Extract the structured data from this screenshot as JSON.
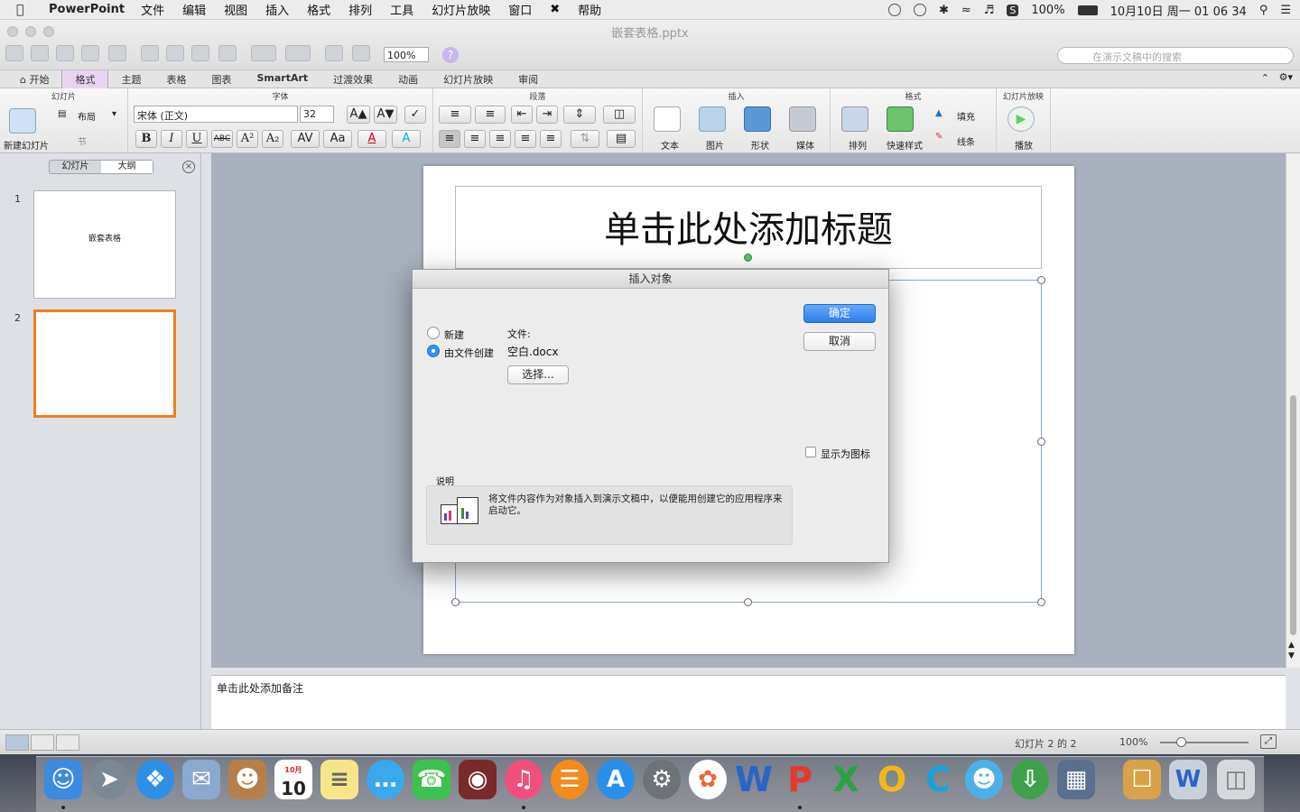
{
  "menubar": {
    "app_name": "PowerPoint",
    "items": [
      "文件",
      "编辑",
      "视图",
      "插入",
      "格式",
      "排列",
      "工具",
      "幻灯片放映",
      "窗口",
      "帮助"
    ],
    "battery": "100%",
    "clock": "10月10日 周一  01 06 34"
  },
  "window": {
    "title": "嵌套表格.pptx"
  },
  "toolbar": {
    "zoom": "100%",
    "search_placeholder": "在演示文稿中的搜索"
  },
  "tabs": [
    "开始",
    "格式",
    "主题",
    "表格",
    "图表",
    "SmartArt",
    "过渡效果",
    "动画",
    "幻灯片放映",
    "审阅"
  ],
  "ribbon": {
    "slides_group": "幻灯片",
    "new_slide": "新建幻灯片",
    "layout": "布局",
    "section": "节",
    "font_group": "字体",
    "font_name": "宋体 (正文)",
    "font_size": "32",
    "paragraph_group": "段落",
    "insert_group": "插入",
    "insert_text": "文本",
    "insert_picture": "图片",
    "insert_shape": "形状",
    "insert_media": "媒体",
    "format_group": "格式",
    "arrange": "排列",
    "quick_styles": "快速样式",
    "fill": "填充",
    "line": "线条",
    "slideshow_group": "幻灯片放映",
    "play": "播放"
  },
  "panel": {
    "tab_slides": "幻灯片",
    "tab_outline": "大纲",
    "slides": [
      {
        "num": "1",
        "text": "嵌套表格"
      },
      {
        "num": "2",
        "text": ""
      }
    ]
  },
  "slide": {
    "title_placeholder": "单击此处添加标题"
  },
  "notes": {
    "placeholder": "单击此处添加备注"
  },
  "status": {
    "slide_count": "幻灯片 2 的 2",
    "zoom": "100%"
  },
  "dialog": {
    "title": "插入对象",
    "opt_new": "新建",
    "opt_from_file": "由文件创建",
    "file_label": "文件:",
    "file_name": "空白.docx",
    "choose_button": "选择...",
    "ok_button": "确定",
    "cancel_button": "取消",
    "display_as_icon": "显示为图标",
    "desc_label": "说明",
    "desc_text": "将文件内容作为对象插入到演示文稿中，以便能用创建它的应用程序来启动它。"
  },
  "dock": {
    "calendar_month": "10月",
    "calendar_day": "10"
  },
  "colors": {
    "accent": "#2b7ef0",
    "selected_slide": "#f07f1a",
    "tab_active": "#e8d4ee"
  }
}
